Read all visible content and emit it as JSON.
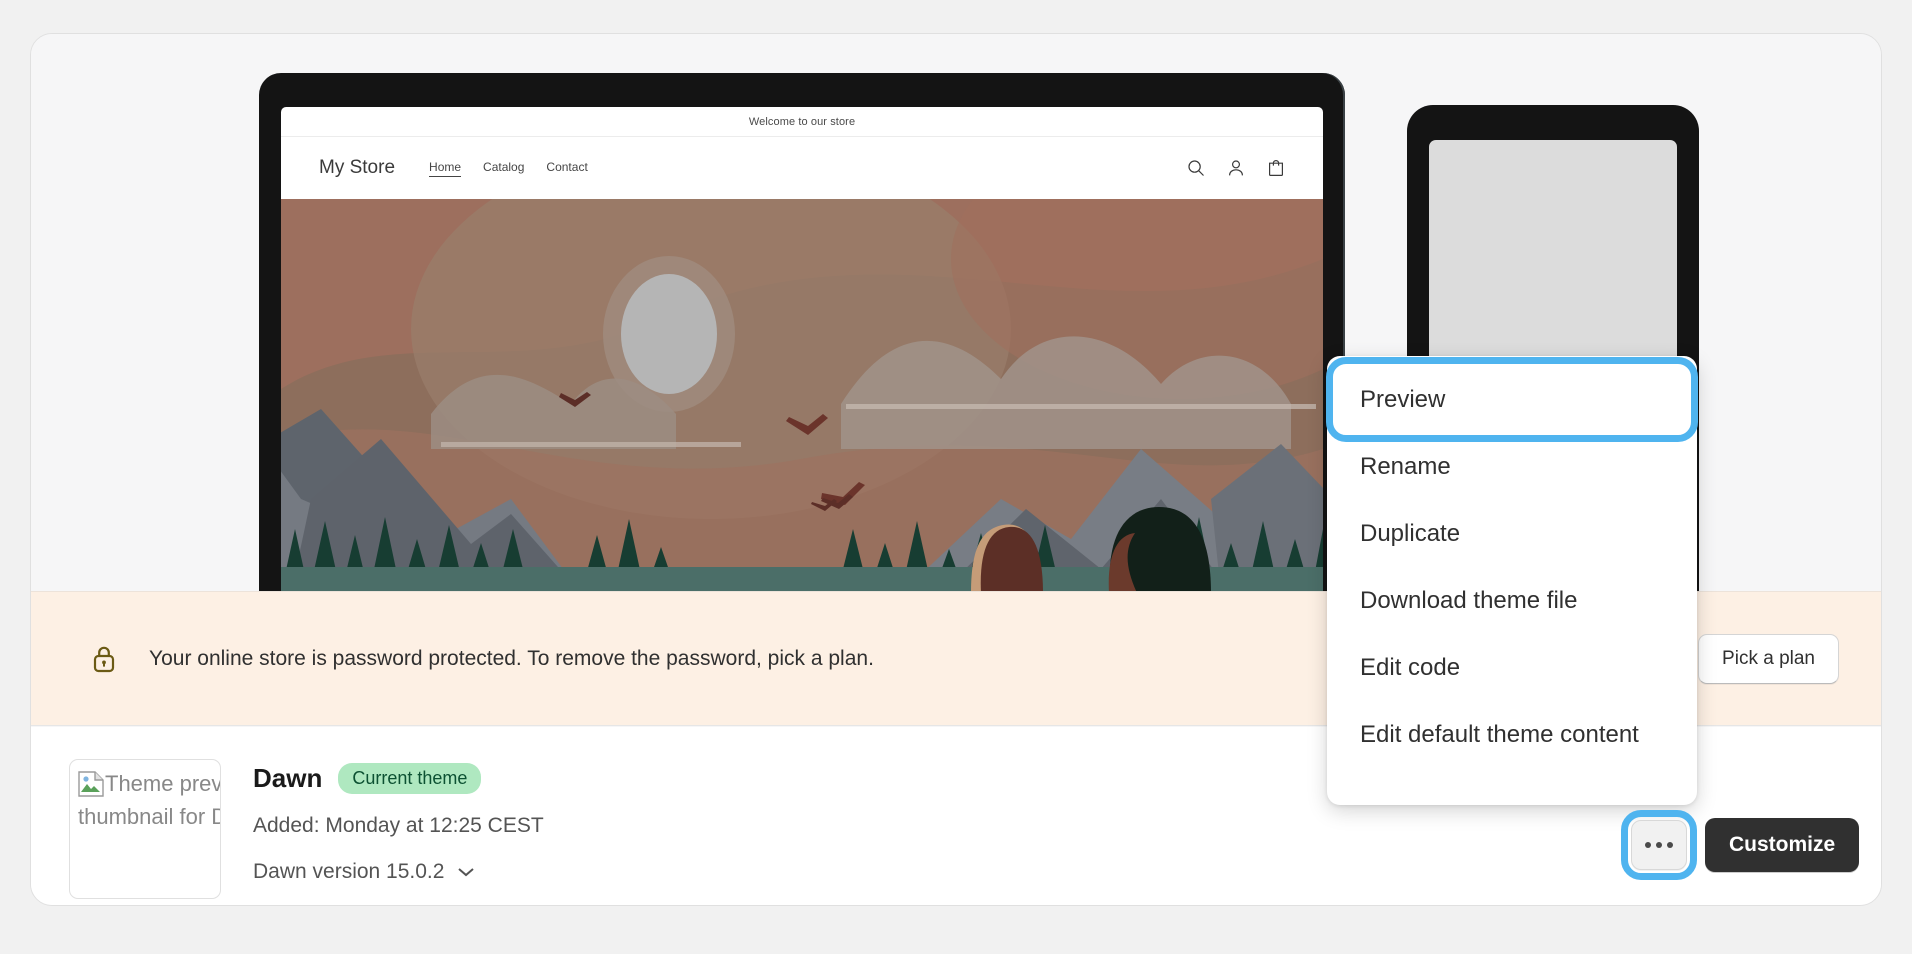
{
  "store_preview": {
    "announcement": "Welcome to our store",
    "logo": "My Store",
    "nav": [
      {
        "label": "Home",
        "active": true
      },
      {
        "label": "Catalog",
        "active": false
      },
      {
        "label": "Contact",
        "active": false
      }
    ],
    "icons": [
      "search-icon",
      "account-icon",
      "cart-icon"
    ]
  },
  "banner": {
    "icon": "lock-icon",
    "message": "Your online store is password protected. To remove the password, pick a plan.",
    "action_label": "Pick a plan"
  },
  "theme": {
    "thumbnail_alt": "Theme preview thumbnail for Dawn",
    "name": "Dawn",
    "badge": "Current theme",
    "added": "Added: Monday at 12:25 CEST",
    "version": "Dawn version 15.0.2"
  },
  "menu": {
    "items": [
      {
        "label": "Preview",
        "focused": true
      },
      {
        "label": "Rename",
        "focused": false
      },
      {
        "label": "Duplicate",
        "focused": false
      },
      {
        "label": "Download theme file",
        "focused": false
      },
      {
        "label": "Edit code",
        "focused": false
      },
      {
        "label": "Edit default theme content",
        "focused": false
      }
    ]
  },
  "actions": {
    "more_label": "...",
    "customize_label": "Customize"
  },
  "colors": {
    "focus_ring": "#4FB4EF",
    "banner_bg": "#FDF0E4",
    "badge_bg": "#AFE8C0",
    "badge_text": "#0C5132",
    "primary_button": "#303030"
  }
}
